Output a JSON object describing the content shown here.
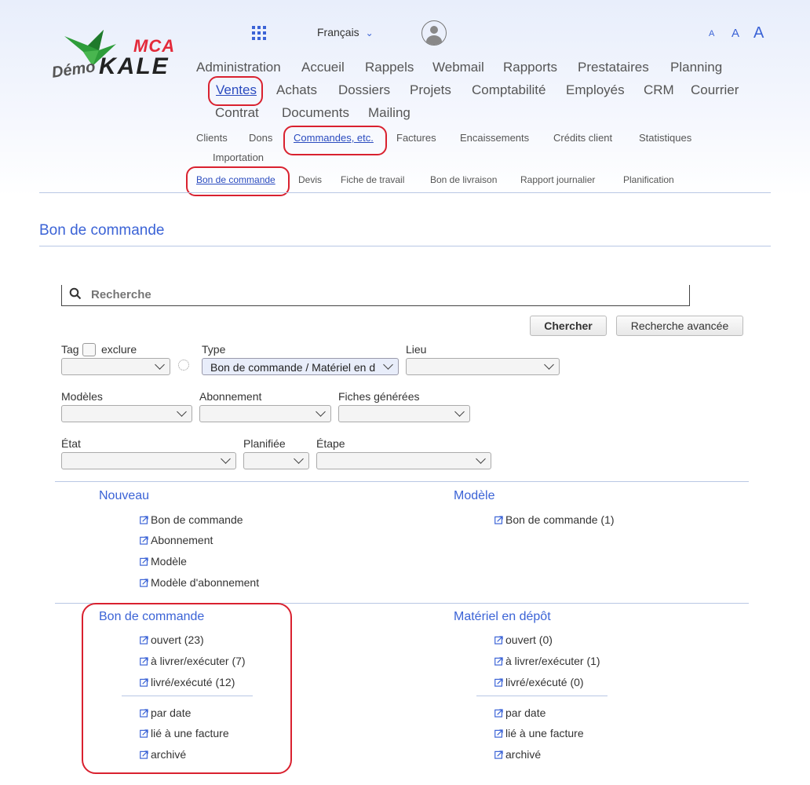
{
  "colors": {
    "accent": "#3b63d6",
    "highlight": "#d9212f"
  },
  "logo": {
    "demo": "Démo",
    "mca": "MCA",
    "kale": "KALE"
  },
  "header": {
    "apps_icon": "grid-icon",
    "language": "Français",
    "user_icon": "user-avatar-icon",
    "font_small": "A",
    "font_medium": "A",
    "font_large": "A"
  },
  "nav": {
    "main": [
      "Administration",
      "Accueil",
      "Rappels",
      "Webmail",
      "Rapports",
      "Prestataires",
      "Planning",
      "Ventes",
      "Achats",
      "Dossiers",
      "Projets",
      "Comptabilité",
      "Employés",
      "CRM",
      "Courrier",
      "Contrat",
      "Documents",
      "Mailing"
    ],
    "sub": [
      "Clients",
      "Dons",
      "Commandes, etc.",
      "Factures",
      "Encaissements",
      "Crédits client",
      "Statistiques",
      "Importation"
    ],
    "sub2": [
      "Bon de commande",
      "Devis",
      "Fiche de travail",
      "Bon de livraison",
      "Rapport journalier",
      "Planification"
    ]
  },
  "page_title": "Bon de commande",
  "search": {
    "placeholder": "Recherche",
    "search_button": "Chercher",
    "advanced_button": "Recherche avancée"
  },
  "filters": {
    "tag": "Tag",
    "exclude": "exclure",
    "type": "Type",
    "type_value": "Bon de commande / Matériel en d",
    "lieu": "Lieu",
    "modeles": "Modèles",
    "abonnement": "Abonnement",
    "fiches": "Fiches générées",
    "etat": "État",
    "planifiee": "Planifiée",
    "etape": "Étape"
  },
  "sections": {
    "nouveau": {
      "title": "Nouveau",
      "items": [
        "Bon de commande",
        "Abonnement",
        "Modèle",
        "Modèle d'abonnement"
      ]
    },
    "modele": {
      "title": "Modèle",
      "items": [
        "Bon de commande (1)"
      ]
    },
    "bon": {
      "title": "Bon de commande",
      "items": [
        "ouvert (23)",
        "à livrer/exécuter (7)",
        "livré/exécuté (12)",
        "par date",
        "lié à une facture",
        "archivé"
      ]
    },
    "depot": {
      "title": "Matériel en dépôt",
      "items": [
        "ouvert (0)",
        "à livrer/exécuter (1)",
        "livré/exécuté (0)",
        "par date",
        "lié à une facture",
        "archivé"
      ]
    }
  }
}
